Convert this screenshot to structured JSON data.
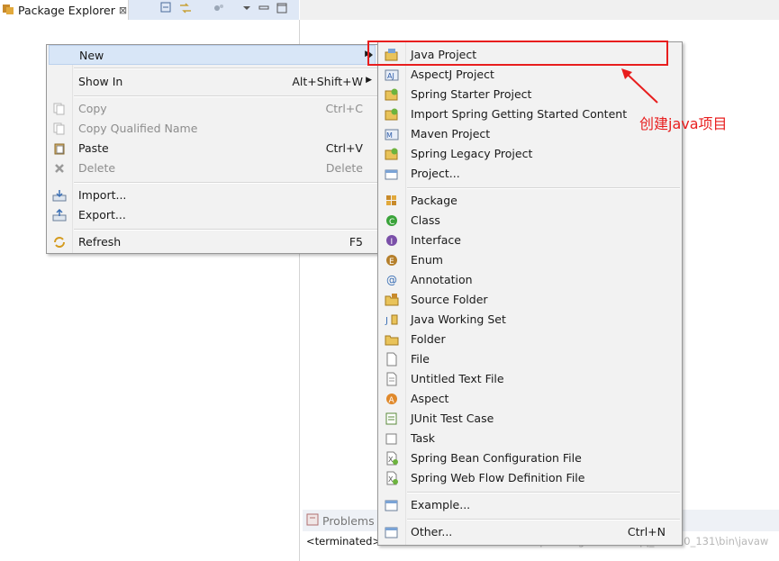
{
  "view": {
    "title": "Package Explorer",
    "close_glyph": "⊠"
  },
  "context_menu": {
    "items": [
      {
        "label": "New",
        "accelerator": "",
        "icon": "none",
        "submenu": true,
        "enabled": true
      },
      {
        "label": "Show In",
        "accelerator": "Alt+Shift+W",
        "icon": "none",
        "submenu": true,
        "enabled": true
      },
      {
        "label": "Copy",
        "accelerator": "Ctrl+C",
        "icon": "copy-icon",
        "enabled": false
      },
      {
        "label": "Copy Qualified Name",
        "accelerator": "",
        "icon": "copy-qualified-icon",
        "enabled": false
      },
      {
        "label": "Paste",
        "accelerator": "Ctrl+V",
        "icon": "paste-icon",
        "enabled": true
      },
      {
        "label": "Delete",
        "accelerator": "Delete",
        "icon": "delete-icon",
        "enabled": false
      },
      {
        "label": "Import...",
        "accelerator": "",
        "icon": "import-icon",
        "enabled": true
      },
      {
        "label": "Export...",
        "accelerator": "",
        "icon": "export-icon",
        "enabled": true
      },
      {
        "label": "Refresh",
        "accelerator": "F5",
        "icon": "refresh-icon",
        "enabled": true
      }
    ]
  },
  "new_submenu": {
    "items": [
      {
        "label": "Java Project",
        "icon": "java-project-icon"
      },
      {
        "label": "AspectJ Project",
        "icon": "aspectj-project-icon"
      },
      {
        "label": "Spring Starter Project",
        "icon": "spring-starter-icon"
      },
      {
        "label": "Import Spring Getting Started Content",
        "icon": "spring-import-icon"
      },
      {
        "label": "Maven Project",
        "icon": "maven-project-icon"
      },
      {
        "label": "Spring Legacy Project",
        "icon": "spring-legacy-icon"
      },
      {
        "label": "Project...",
        "icon": "project-icon"
      },
      {
        "label": "Package",
        "icon": "package-icon"
      },
      {
        "label": "Class",
        "icon": "class-icon"
      },
      {
        "label": "Interface",
        "icon": "interface-icon"
      },
      {
        "label": "Enum",
        "icon": "enum-icon"
      },
      {
        "label": "Annotation",
        "icon": "annotation-icon"
      },
      {
        "label": "Source Folder",
        "icon": "source-folder-icon"
      },
      {
        "label": "Java Working Set",
        "icon": "working-set-icon"
      },
      {
        "label": "Folder",
        "icon": "folder-icon"
      },
      {
        "label": "File",
        "icon": "file-icon"
      },
      {
        "label": "Untitled Text File",
        "icon": "text-file-icon"
      },
      {
        "label": "Aspect",
        "icon": "aspect-icon"
      },
      {
        "label": "JUnit Test Case",
        "icon": "junit-icon"
      },
      {
        "label": "Task",
        "icon": "task-icon"
      },
      {
        "label": "Spring Bean Configuration File",
        "icon": "spring-bean-icon"
      },
      {
        "label": "Spring Web Flow Definition File",
        "icon": "spring-webflow-icon"
      },
      {
        "label": "Example...",
        "icon": "example-icon"
      },
      {
        "label": "Other...",
        "icon": "other-icon",
        "accelerator": "Ctrl+N"
      }
    ]
  },
  "annotation": {
    "text": "创建java项目",
    "color": "#e81e1e"
  },
  "bottom_panel": {
    "problems_tab": "Problems",
    "console_prefix": "<terminated>",
    "console_tail": "https://blog.csdn.net/qq_...1.8.0_131\\bin\\javaw"
  },
  "colors": {
    "highlight": "#d8e6f7",
    "menu_bg": "#f2f2f2",
    "tab_blue": "#dfe8f6",
    "annotation_red": "#e81e1e"
  }
}
